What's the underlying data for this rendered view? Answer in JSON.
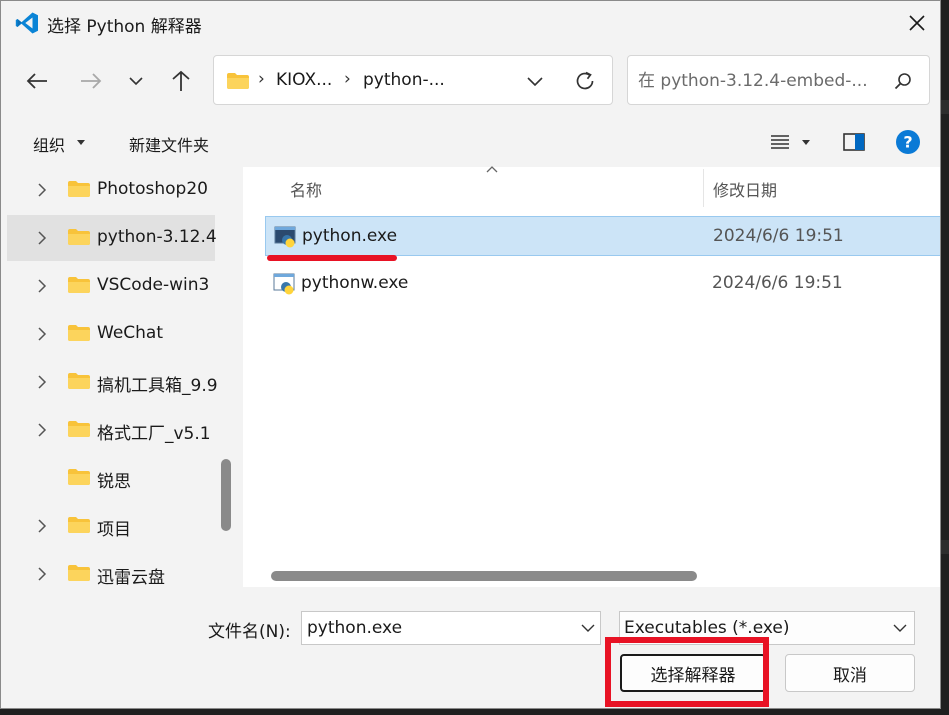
{
  "window": {
    "title": "选择 Python 解释器",
    "app_icon": "vscode-icon",
    "close_icon": "close-icon"
  },
  "nav": {
    "back_icon": "arrow-left-icon",
    "forward_icon": "arrow-right-icon",
    "recent_icon": "chevron-down-icon",
    "up_icon": "arrow-up-icon",
    "breadcrumb": [
      "KIOX...",
      "python-..."
    ],
    "refresh_icon": "refresh-icon",
    "search_placeholder": "在 python-3.12.4-embed-..."
  },
  "toolbar": {
    "organize_label": "组织",
    "new_folder_label": "新建文件夹"
  },
  "sidebar": {
    "items": [
      {
        "label": "Photoshop20",
        "has_children": true,
        "selected": false
      },
      {
        "label": "python-3.12.4",
        "has_children": true,
        "selected": true
      },
      {
        "label": "VSCode-win3",
        "has_children": true,
        "selected": false
      },
      {
        "label": "WeChat",
        "has_children": true,
        "selected": false
      },
      {
        "label": "搞机工具箱_9.9",
        "has_children": true,
        "selected": false
      },
      {
        "label": "格式工厂_v5.1",
        "has_children": true,
        "selected": false
      },
      {
        "label": "锐思",
        "has_children": false,
        "selected": false
      },
      {
        "label": "项目",
        "has_children": true,
        "selected": false
      },
      {
        "label": "迅雷云盘",
        "has_children": true,
        "selected": false
      }
    ]
  },
  "file_list": {
    "columns": {
      "name": "名称",
      "date_modified": "修改日期"
    },
    "rows": [
      {
        "name": "python.exe",
        "date": "2024/6/6 19:51",
        "selected": true
      },
      {
        "name": "pythonw.exe",
        "date": "2024/6/6 19:51",
        "selected": false
      }
    ]
  },
  "footer": {
    "filename_label": "文件名(N):",
    "filename_value": "python.exe",
    "filetype_value": "Executables (*.exe)",
    "select_button": "选择解释器",
    "cancel_button": "取消"
  },
  "colors": {
    "accent": "#0067c0",
    "selection": "#cce4f7",
    "highlight": "#e81224",
    "folder": "#f8c33a"
  }
}
